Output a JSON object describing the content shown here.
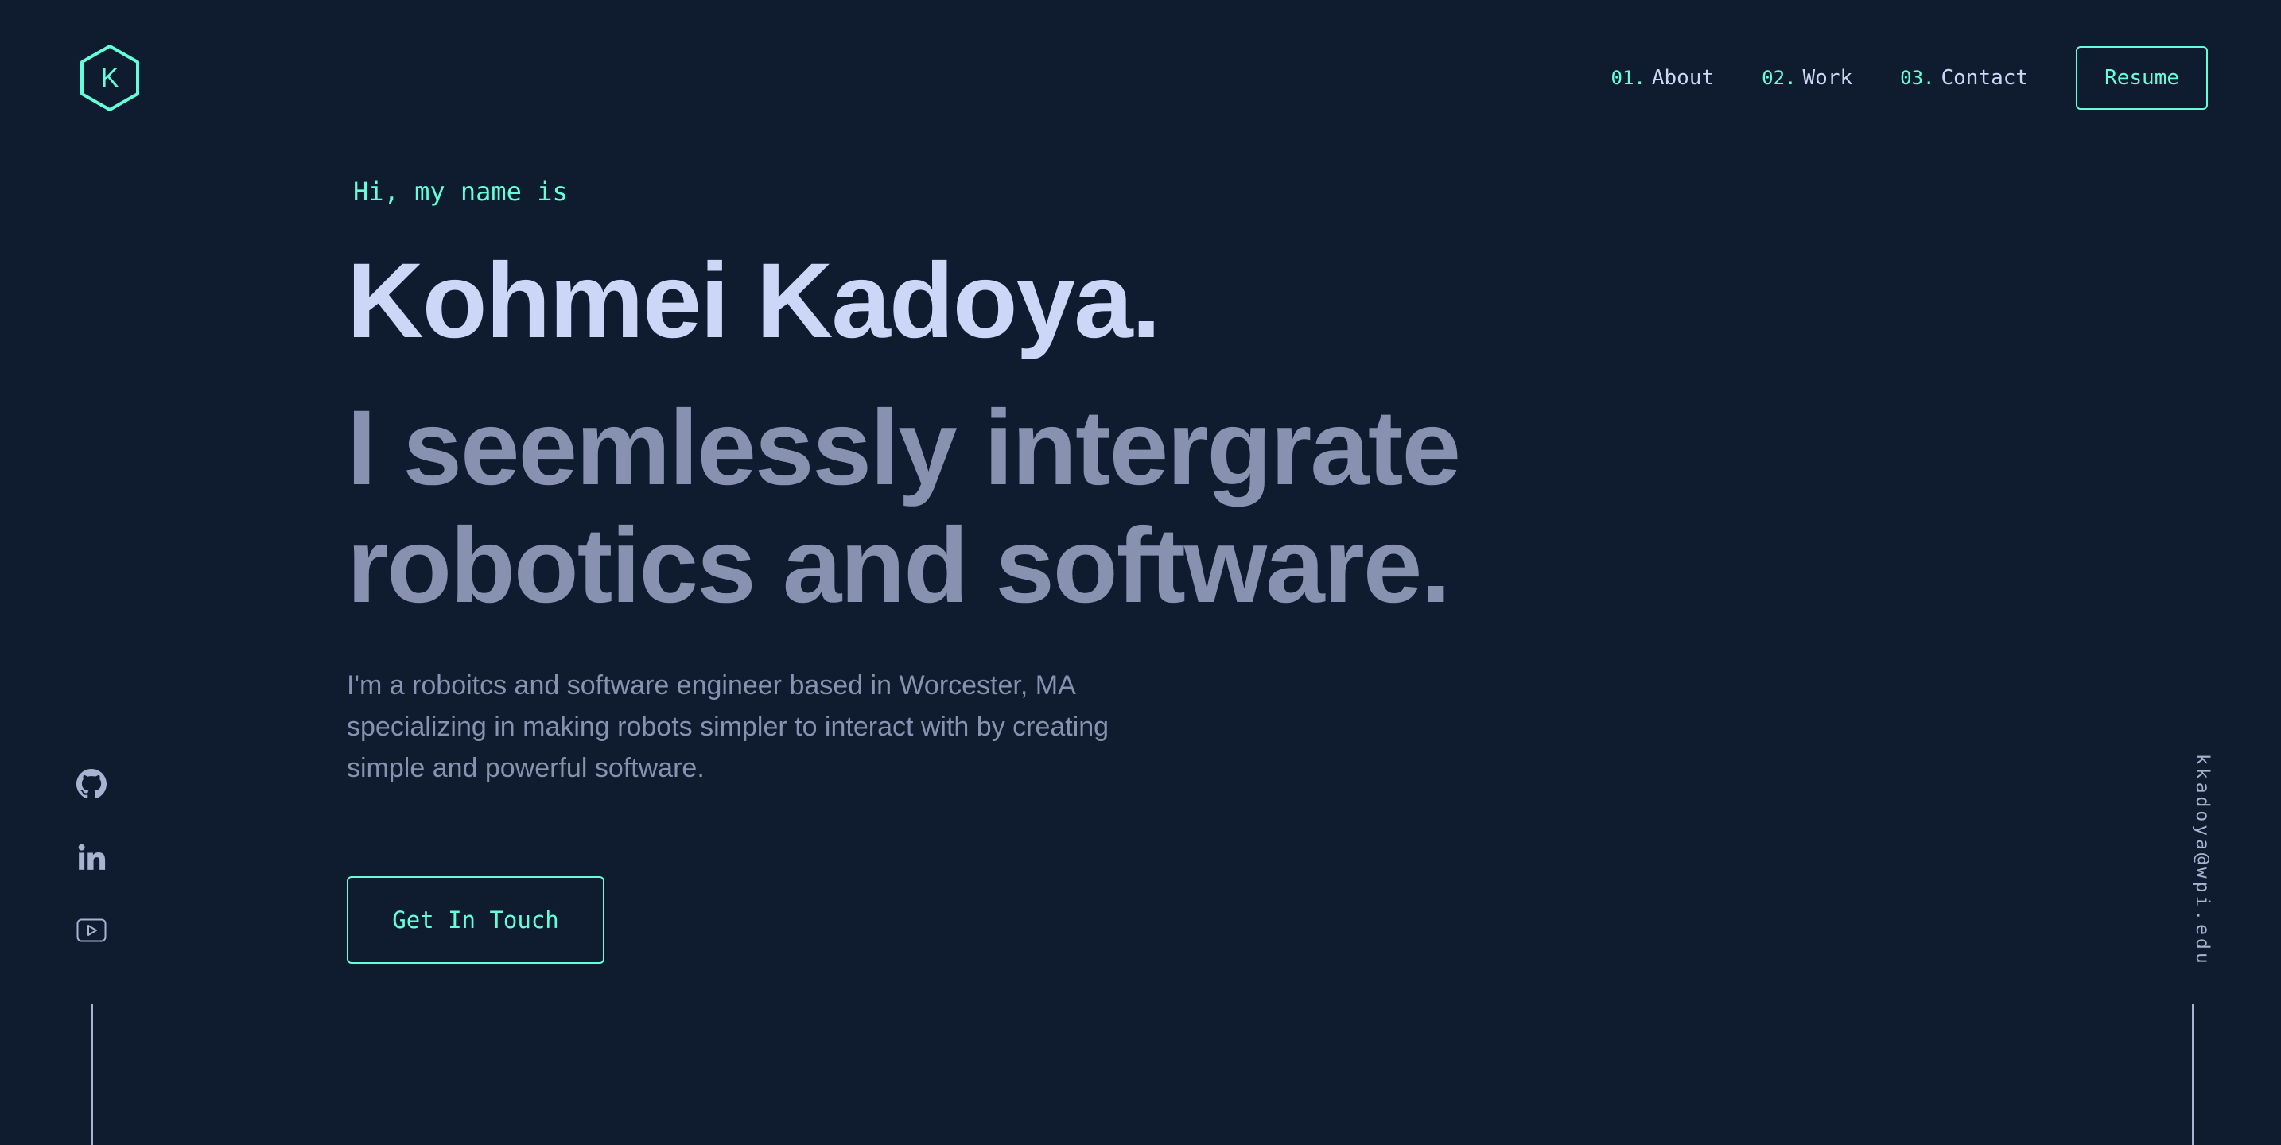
{
  "header": {
    "logo_letter": "K",
    "nav": [
      {
        "num": "01.",
        "label": "About"
      },
      {
        "num": "02.",
        "label": "Work"
      },
      {
        "num": "03.",
        "label": "Contact"
      }
    ],
    "resume_label": "Resume"
  },
  "hero": {
    "greeting": "Hi, my name is",
    "name": "Kohmei Kadoya.",
    "tagline": "I seemlessly intergrate robotics and software.",
    "bio": "I'm a roboitcs and software engineer based in Worcester, MA specializing in making robots simpler to interact with by creating simple and powerful software.",
    "cta_label": "Get In Touch"
  },
  "social": {
    "icons": [
      "github-icon",
      "linkedin-icon",
      "youtube-icon"
    ]
  },
  "email": "kkadoya@wpi.edu",
  "colors": {
    "background": "#0f1b2e",
    "accent": "#64ffda",
    "heading": "#ccd6f6",
    "muted": "#8892b0"
  }
}
